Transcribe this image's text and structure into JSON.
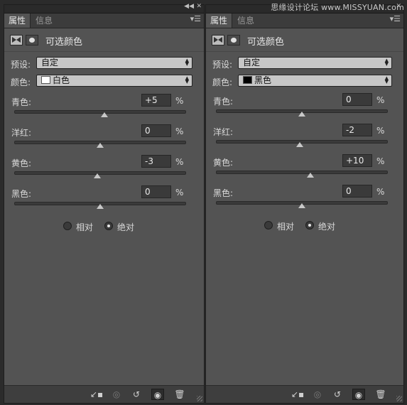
{
  "watermark": "思缘设计论坛 www.MISSYUAN.com",
  "panels": [
    {
      "tabs": [
        "属性",
        "信息"
      ],
      "title": "可选颜色",
      "preset_label": "预设:",
      "preset_value": "自定",
      "colors_label": "颜色:",
      "colors_value": "白色",
      "swatch_color": "#ffffff",
      "sliders": [
        {
          "label": "青色:",
          "value": "+5",
          "unit": "%",
          "percent": 5
        },
        {
          "label": "洋红:",
          "value": "0",
          "unit": "%",
          "percent": 0
        },
        {
          "label": "黄色:",
          "value": "-3",
          "unit": "%",
          "percent": -3
        },
        {
          "label": "黑色:",
          "value": "0",
          "unit": "%",
          "percent": 0
        }
      ],
      "method": {
        "relative": "相对",
        "absolute": "绝对",
        "selected": "absolute"
      }
    },
    {
      "tabs": [
        "属性",
        "信息"
      ],
      "title": "可选颜色",
      "preset_label": "预设:",
      "preset_value": "自定",
      "colors_label": "颜色:",
      "colors_value": "黑色",
      "swatch_color": "#000000",
      "sliders": [
        {
          "label": "青色:",
          "value": "0",
          "unit": "%",
          "percent": 0
        },
        {
          "label": "洋红:",
          "value": "-2",
          "unit": "%",
          "percent": -2
        },
        {
          "label": "黄色:",
          "value": "+10",
          "unit": "%",
          "percent": 10
        },
        {
          "label": "黑色:",
          "value": "0",
          "unit": "%",
          "percent": 0
        }
      ],
      "method": {
        "relative": "相对",
        "absolute": "绝对",
        "selected": "absolute"
      }
    }
  ],
  "icons": {
    "footer": [
      "clip-to-layer-icon",
      "view-previous-state-icon",
      "reset-icon",
      "visibility-eye-icon",
      "trash-icon"
    ]
  }
}
